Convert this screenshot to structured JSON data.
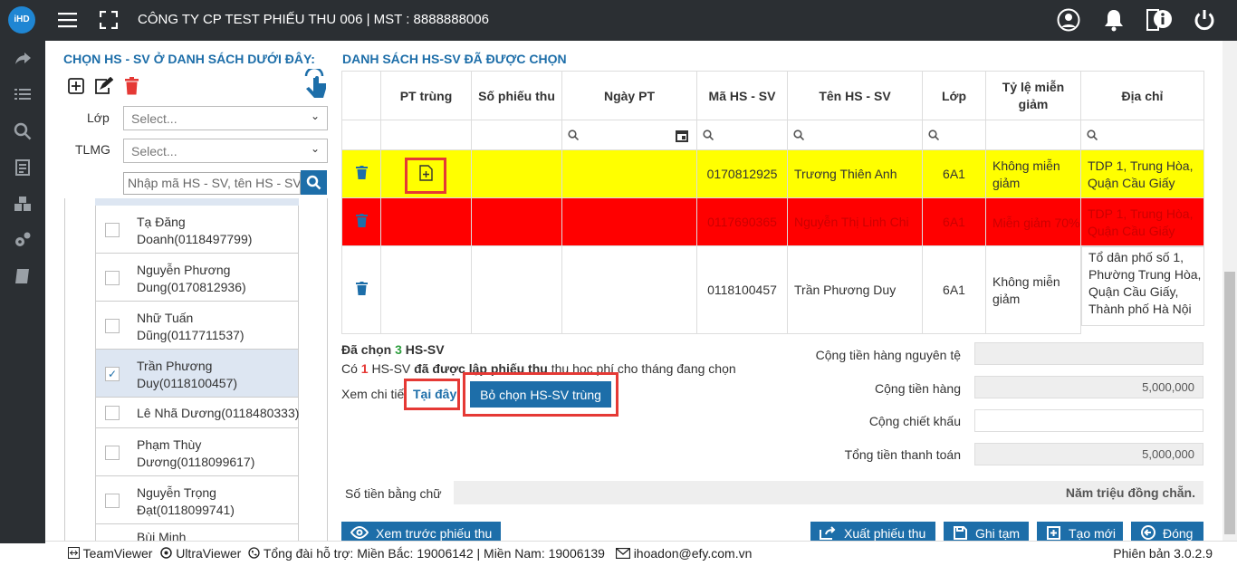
{
  "topbar": {
    "logo_text": "iHD",
    "company": "CÔNG TY CP TEST PHIẾU THU 006 | MST : 8888888006",
    "icons": [
      "menu-icon",
      "fullscreen-icon",
      "user-icon",
      "bell-icon",
      "info-icon",
      "power-icon"
    ]
  },
  "sidebar": {
    "icons": [
      "share-icon",
      "list-icon",
      "search-icon",
      "document-icon",
      "boxes-icon",
      "gears-icon",
      "book-icon"
    ]
  },
  "left_panel": {
    "title": "CHỌN HS - SV Ở DANH SÁCH DƯỚI ĐÂY:",
    "filters": [
      {
        "label": "Lớp",
        "placeholder": "Select..."
      },
      {
        "label": "TLMG",
        "placeholder": "Select..."
      }
    ],
    "search_placeholder": "Nhập mã HS - SV, tên HS - SV",
    "students": [
      {
        "name": "Tạ Đăng Doanh(0118497799)",
        "checked": false
      },
      {
        "name": "Nguyễn Phương Dung(0170812936)",
        "checked": false
      },
      {
        "name": "Nhữ Tuấn Dũng(0117711537)",
        "checked": false
      },
      {
        "name": "Trần Phương Duy(0118100457)",
        "checked": true
      },
      {
        "name": "Lê Nhã Dương(0118480333)",
        "checked": false
      },
      {
        "name": "Phạm Thùy Dương(0118099617)",
        "checked": false
      },
      {
        "name": "Nguyễn Trọng Đạt(0118099741)",
        "checked": false
      },
      {
        "name": "Bùi Minh",
        "checked": false
      }
    ]
  },
  "right_panel": {
    "title": "DANH SÁCH HS-SV ĐÃ ĐƯỢC CHỌN",
    "columns": [
      "",
      "PT trùng",
      "Số phiếu thu",
      "Ngày PT",
      "Mã HS - SV",
      "Tên HS - SV",
      "Lớp",
      "Tỷ lệ miễn giảm",
      "Địa chỉ"
    ],
    "rows": [
      {
        "code": "0170812925",
        "name": "Trương Thiên Anh",
        "class": "6A1",
        "discount": "Không miễn giảm",
        "address": "TDP 1, Trung Hòa, Quận Cầu Giấy",
        "status": "duplicate"
      },
      {
        "code": "0117690365",
        "name": "Nguyễn Thị Linh Chi",
        "class": "6A1",
        "discount": "Miễn giảm 70%",
        "address": "TDP 1, Trung Hòa, Quận Cầu Giấy",
        "status": "error"
      },
      {
        "code": "0118100457",
        "name": "Trần Phương Duy",
        "class": "6A1",
        "discount": "Không miễn giảm",
        "address": "Tổ dân phố số 1, Phường Trung Hòa, Quận Cầu Giấy, Thành phố Hà Nội",
        "status": "normal"
      }
    ],
    "selected_prefix": "Đã chọn ",
    "selected_count": "3",
    "selected_suffix": " HS-SV",
    "dup_prefix": "Có ",
    "dup_count": "1",
    "dup_mid": " HS-SV ",
    "dup_bold": "đã được lập phiếu thu",
    "dup_suffix": " thu học phí cho tháng đang chọn",
    "detail_prefix": "Xem chi tiết",
    "detail_link": "Tại đây",
    "deselect_button": "Bỏ chọn HS-SV trùng",
    "totals": [
      {
        "label": "Cộng tiền hàng nguyên tệ",
        "value": ""
      },
      {
        "label": "Cộng tiền hàng",
        "value": "5,000,000"
      },
      {
        "label": "Cộng chiết khấu",
        "value": ""
      },
      {
        "label": "Tổng tiền thanh toán",
        "value": "5,000,000"
      }
    ],
    "words_label": "Số tiền bằng chữ",
    "words_value": "Năm triệu đồng chẵn.",
    "buttons": {
      "preview": "Xem trước phiếu thu",
      "export": "Xuất phiếu thu",
      "save": "Ghi tạm",
      "new": "Tạo mới",
      "close": "Đóng"
    }
  },
  "footer": {
    "teamviewer": "TeamViewer",
    "ultraviewer": "UltraViewer",
    "hotline": "Tổng đài hỗ trợ: Miền Bắc: 19006142 | Miền Nam: 19006139",
    "email": "ihoadon@efy.com.vn",
    "version": "Phiên bản 3.0.2.9"
  },
  "colors": {
    "topbar": "#2b2f33",
    "accent": "#1d6ea9",
    "duplicate_row": "#ffff00",
    "error_row": "#ff0000",
    "highlight_box": "#e53935"
  }
}
